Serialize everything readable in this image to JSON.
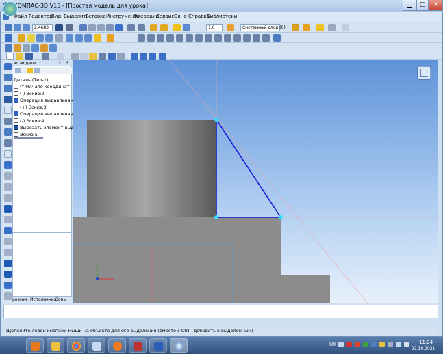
{
  "window": {
    "title": "КОМПАС-3D V15 - [Простая модель для урока]",
    "min_glyph": "▁",
    "max_glyph": "□",
    "close_glyph": "✕"
  },
  "menu": [
    "Файл",
    "Редактор",
    "Вид",
    "Выделить",
    "Вставка",
    "Инструменты",
    "Операции",
    "Сервис",
    "Окно",
    "Справка",
    "Библиотеки"
  ],
  "toolbar": {
    "zoom_value": "2.4683",
    "step_value": "1.0",
    "layer_value": "Системный слой (0)"
  },
  "tree": {
    "header": "во модели",
    "items": [
      {
        "label": "Деталь (Тел-1)",
        "icon": "part-icon"
      },
      {
        "label": "(т)Начало координат",
        "icon": "axes-icon"
      },
      {
        "label": "(-) Эскиз:2",
        "icon": "sketch-icon"
      },
      {
        "label": "Операция выдавливания",
        "icon": "extrude-icon"
      },
      {
        "label": "(+) Эскиз:3",
        "icon": "sketch-icon"
      },
      {
        "label": "Операция выдавливания",
        "icon": "extrude-icon"
      },
      {
        "label": "(-) Эскиз:4",
        "icon": "sketch-icon"
      },
      {
        "label": "Вырезать элемент выдав",
        "icon": "cut-icon"
      },
      {
        "label": "Эскиз:5",
        "icon": "sketch-icon"
      }
    ]
  },
  "tabs": [
    "роение",
    "Исполнения",
    "Зоны"
  ],
  "statusbar": {
    "text": "Щелкните левой кнопкой мыши на объекте для его выделения (вместе с Ctrl - добавить к выделенным)"
  },
  "taskbar": {
    "language": "UK",
    "time": "11:24",
    "date": "23.10.2021"
  },
  "colors": {
    "sketch_line": "#1a1ad6",
    "highlight_point": "#33e0ff",
    "body_gray": "#8c8c8c"
  }
}
